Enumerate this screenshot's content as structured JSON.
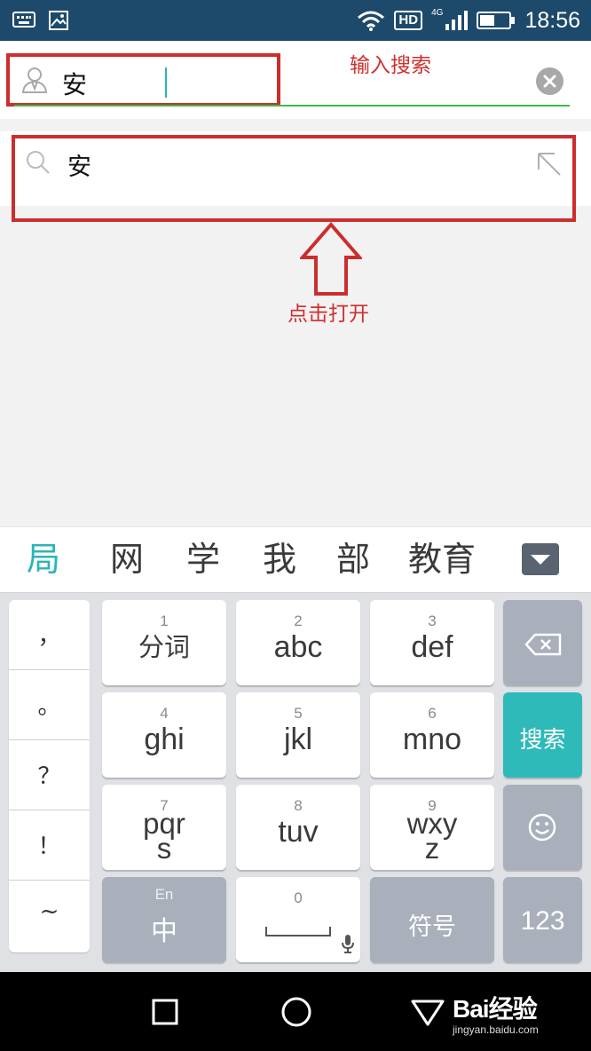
{
  "status_bar": {
    "time": "18:56",
    "hd_label": "HD",
    "network_label": "4G",
    "icons": [
      "keyboard-icon",
      "image-icon",
      "wifi-icon",
      "signal-icon",
      "battery-icon"
    ]
  },
  "search": {
    "query": "安",
    "annotation": "输入搜索",
    "accent_color": "#3cbc48",
    "cursor_color": "#28b4bc"
  },
  "suggestion": {
    "text": "安",
    "annotation": "点击打开"
  },
  "candidates": [
    "局",
    "网",
    "学",
    "我",
    "部",
    "教育"
  ],
  "keyboard": {
    "punctuation": [
      "，",
      "。",
      "？",
      "！",
      "~"
    ],
    "keys": [
      {
        "num": "1",
        "label": "分词"
      },
      {
        "num": "2",
        "label": "abc"
      },
      {
        "num": "3",
        "label": "def"
      },
      {
        "num": "4",
        "label": "ghi"
      },
      {
        "num": "5",
        "label": "jkl"
      },
      {
        "num": "6",
        "label": "mno"
      },
      {
        "num": "7",
        "label": "pqr",
        "label2": "s"
      },
      {
        "num": "8",
        "label": "tuv"
      },
      {
        "num": "9",
        "label": "wxy",
        "label2": "z"
      }
    ],
    "search_key": "搜索",
    "lang_sub": "En",
    "lang_main": "中",
    "space_num": "0",
    "symbols_key": "符号",
    "numbers_key": "123",
    "teal_color": "#2dbab9"
  },
  "watermark": {
    "logo": "Bai经验",
    "site": "jingyan.baidu.com"
  }
}
